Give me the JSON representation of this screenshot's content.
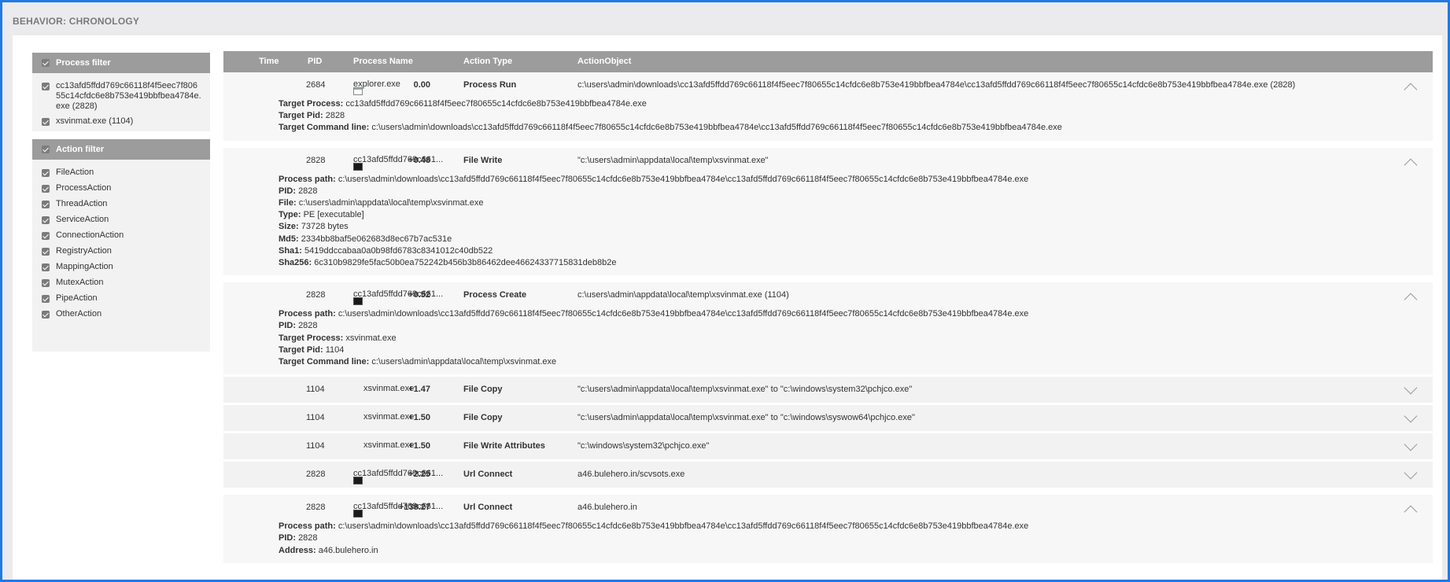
{
  "section": {
    "title": "BEHAVIOR: CHRONOLOGY"
  },
  "process_filter": {
    "title": "Process filter",
    "items": [
      "cc13afd5ffdd769c66118f4f5eec7f80655c14cfdc6e8b753e419bbfbea4784e.exe (2828)",
      "xsvinmat.exe (1104)"
    ]
  },
  "action_filter": {
    "title": "Action filter",
    "items": [
      "FileAction",
      "ProcessAction",
      "ThreadAction",
      "ServiceAction",
      "ConnectionAction",
      "RegistryAction",
      "MappingAction",
      "MutexAction",
      "PipeAction",
      "OtherAction"
    ]
  },
  "table": {
    "headers": {
      "time": "Time",
      "pid": "PID",
      "process_name": "Process Name",
      "action_type": "Action Type",
      "action_object": "ActionObject"
    },
    "rows": [
      {
        "time": "0.00",
        "pid": "2684",
        "icon": "explorer-icon",
        "process_name": "explorer.exe",
        "action_type": "Process Run",
        "action_object": "c:\\users\\admin\\downloads\\cc13afd5ffdd769c66118f4f5eec7f80655c14cfdc6e8b753e419bbfbea4784e\\cc13afd5ffdd769c66118f4f5eec7f80655c14cfdc6e8b753e419bbfbea4784e.exe (2828)",
        "expanded": true,
        "details": [
          {
            "k": "Target Process:",
            "v": "cc13afd5ffdd769c66118f4f5eec7f80655c14cfdc6e8b753e419bbfbea4784e.exe"
          },
          {
            "k": "Target Pid:",
            "v": "2828"
          },
          {
            "k": "Target Command line:",
            "v": "c:\\users\\admin\\downloads\\cc13afd5ffdd769c66118f4f5eec7f80655c14cfdc6e8b753e419bbfbea4784e\\cc13afd5ffdd769c66118f4f5eec7f80655c14cfdc6e8b753e419bbfbea4784e.exe"
          }
        ]
      },
      {
        "time": "+0.48",
        "pid": "2828",
        "icon": "console-icon",
        "process_name": "cc13afd5ffdd769c661...",
        "action_type": "File Write",
        "action_object": "\"c:\\users\\admin\\appdata\\local\\temp\\xsvinmat.exe\"",
        "expanded": true,
        "details": [
          {
            "k": "Process path:",
            "v": "c:\\users\\admin\\downloads\\cc13afd5ffdd769c66118f4f5eec7f80655c14cfdc6e8b753e419bbfbea4784e\\cc13afd5ffdd769c66118f4f5eec7f80655c14cfdc6e8b753e419bbfbea4784e.exe"
          },
          {
            "k": "PID:",
            "v": "2828"
          },
          {
            "k": "File:",
            "v": "c:\\users\\admin\\appdata\\local\\temp\\xsvinmat.exe"
          },
          {
            "k": "Type:",
            "v": "PE [executable]"
          },
          {
            "k": "Size:",
            "v": "73728 bytes"
          },
          {
            "k": "Md5:",
            "v": "2334bb8baf5e062683d8ec67b7ac531e"
          },
          {
            "k": "Sha1:",
            "v": "5419ddccabaa0a0b98fd6783c8341012c40db522"
          },
          {
            "k": "Sha256:",
            "v": "6c310b9829fe5fac50b0ea752242b456b3b86462dee46624337715831deb8b2e"
          }
        ]
      },
      {
        "time": "+0.52",
        "pid": "2828",
        "icon": "console-icon",
        "process_name": "cc13afd5ffdd769c661...",
        "action_type": "Process Create",
        "action_object": "c:\\users\\admin\\appdata\\local\\temp\\xsvinmat.exe (1104)",
        "expanded": true,
        "details": [
          {
            "k": "Process path:",
            "v": "c:\\users\\admin\\downloads\\cc13afd5ffdd769c66118f4f5eec7f80655c14cfdc6e8b753e419bbfbea4784e\\cc13afd5ffdd769c66118f4f5eec7f80655c14cfdc6e8b753e419bbfbea4784e.exe"
          },
          {
            "k": "PID:",
            "v": "2828"
          },
          {
            "k": "Target Process:",
            "v": "xsvinmat.exe"
          },
          {
            "k": "Target Pid:",
            "v": "1104"
          },
          {
            "k": "Target Command line:",
            "v": "c:\\users\\admin\\appdata\\local\\temp\\xsvinmat.exe"
          }
        ]
      },
      {
        "time": "+1.47",
        "pid": "1104",
        "icon": "",
        "process_name": "xsvinmat.exe",
        "action_type": "File Copy",
        "action_object": "\"c:\\users\\admin\\appdata\\local\\temp\\xsvinmat.exe\" to \"c:\\windows\\system32\\pchjco.exe\"",
        "expanded": false,
        "details": []
      },
      {
        "time": "+1.50",
        "pid": "1104",
        "icon": "",
        "process_name": "xsvinmat.exe",
        "action_type": "File Copy",
        "action_object": "\"c:\\users\\admin\\appdata\\local\\temp\\xsvinmat.exe\" to \"c:\\windows\\syswow64\\pchjco.exe\"",
        "expanded": false,
        "details": []
      },
      {
        "time": "+1.50",
        "pid": "1104",
        "icon": "",
        "process_name": "xsvinmat.exe",
        "action_type": "File Write Attributes",
        "action_object": "\"c:\\windows\\system32\\pchjco.exe\"",
        "expanded": false,
        "details": []
      },
      {
        "time": "+2.25",
        "pid": "2828",
        "icon": "console-icon",
        "process_name": "cc13afd5ffdd769c661...",
        "action_type": "Url Connect",
        "action_object": "a46.bulehero.in/scvsots.exe",
        "expanded": false,
        "details": []
      },
      {
        "time": "+138.27",
        "pid": "2828",
        "icon": "console-icon",
        "process_name": "cc13afd5ffdd769c661...",
        "action_type": "Url Connect",
        "action_object": "a46.bulehero.in",
        "expanded": true,
        "details": [
          {
            "k": "Process path:",
            "v": "c:\\users\\admin\\downloads\\cc13afd5ffdd769c66118f4f5eec7f80655c14cfdc6e8b753e419bbfbea4784e\\cc13afd5ffdd769c66118f4f5eec7f80655c14cfdc6e8b753e419bbfbea4784e.exe"
          },
          {
            "k": "PID:",
            "v": "2828"
          },
          {
            "k": "Address:",
            "v": "a46.bulehero.in"
          }
        ]
      }
    ]
  }
}
